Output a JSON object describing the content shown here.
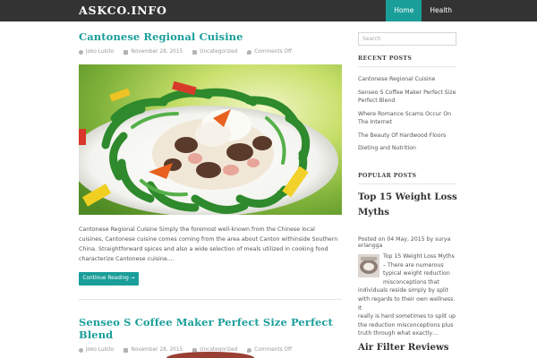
{
  "header": {
    "brand": "ASKCO.INFO",
    "nav": [
      "Home",
      "Health"
    ]
  },
  "posts": [
    {
      "title": "Cantonese Regional Cuisine",
      "author": "Joko Lukito",
      "date": "November 28, 2015",
      "category": "Uncategorized",
      "comments": "Comments Off",
      "excerpt": "Cantonese Regional Cuisine Simply the foremost well-known from the Chinese local cuisines, Cantonese cuisine comes coming from the area about Canton withinside Southern China. Straightforward spices and also a wide selection of meals utilized in cooking food characterize Cantonese cuisine....",
      "read_more": "Continue Reading →"
    },
    {
      "title": "Senseo S Coffee Maker Perfect Size Perfect Blend",
      "author": "Joko Lukito",
      "date": "November 28, 2015",
      "category": "Uncategorized",
      "comments": "Comments Off"
    }
  ],
  "sidebar": {
    "search_placeholder": "Search",
    "recent_title": "RECENT POSTS",
    "recent_posts": [
      "Cantonese Regional Cuisine",
      "Senseo S Coffee Maker Perfect Size Perfect Blend",
      "Where Romance Scams Occur On The Internet",
      "The Beauty Of Hardwood Floors",
      "Dieting and Nutrition"
    ],
    "popular_title": "POPULAR POSTS",
    "popular": [
      {
        "title": "Top 15 Weight Loss Myths",
        "meta": "Posted on 04 May, 2015 by surya erlangga",
        "excerpt_lines": [
          "Top 15 Weight Loss Myths",
          "– There are numerous",
          "typical weight reduction",
          "misconceptions that",
          "individuals reside simply by split",
          "with regards to their own wellness. It",
          "really is hard sometimes to split up",
          "the reduction misconceptions plus",
          "truth through what exactly…"
        ]
      },
      {
        "title": "Air Filter Reviews"
      }
    ]
  },
  "colors": {
    "accent": "#1a9e9a",
    "topbar": "#333333"
  }
}
